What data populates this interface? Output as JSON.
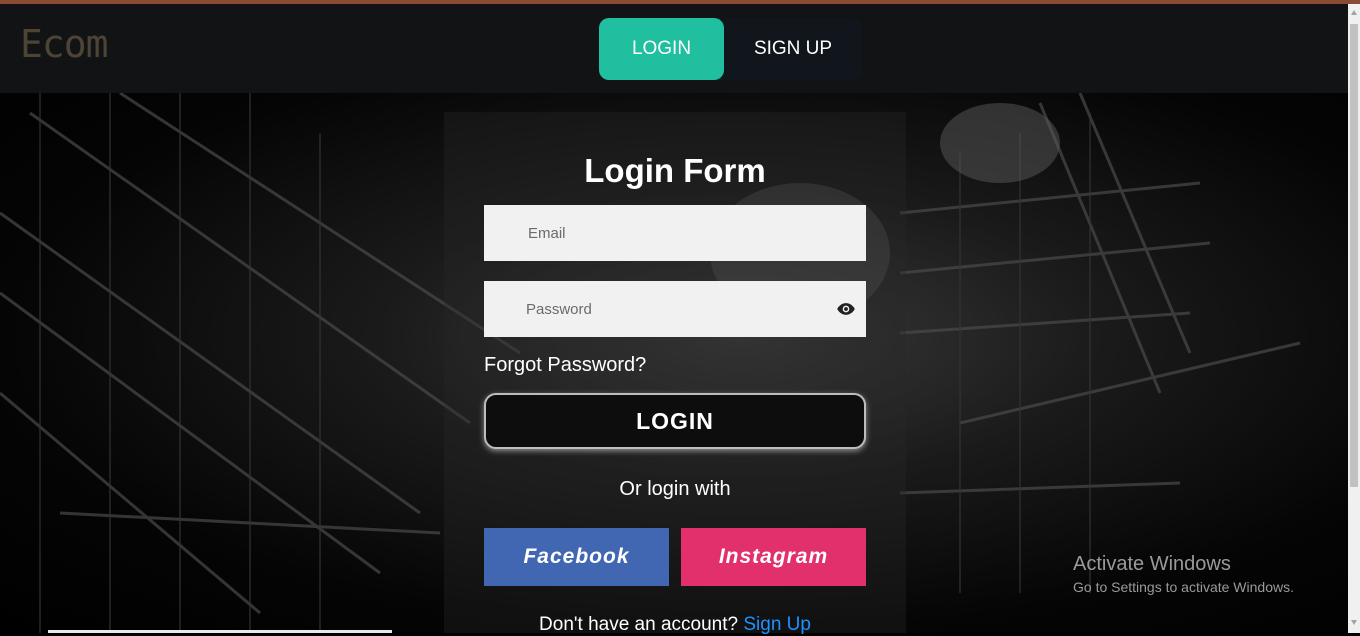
{
  "header": {
    "brand": "Ecom",
    "tabs": [
      {
        "label": "LOGIN",
        "active": true
      },
      {
        "label": "SIGN UP",
        "active": false
      }
    ]
  },
  "form": {
    "title": "Login Form",
    "email_placeholder": "Email",
    "password_placeholder": "Password",
    "forgot_password": "Forgot Password?",
    "login_button": "LOGIN",
    "or_text": "Or login with",
    "facebook_button": "Facebook",
    "instagram_button": "Instagram",
    "no_account_text": "Don't have an account?",
    "signup_link": "Sign Up"
  },
  "watermark": {
    "title": "Activate Windows",
    "subtitle": "Go to Settings to activate Windows."
  },
  "colors": {
    "accent": "#1fbf9f",
    "facebook": "#4267b2",
    "instagram": "#e1306c",
    "link": "#1e90ff"
  },
  "icons": {
    "password_toggle": "eye-icon"
  }
}
